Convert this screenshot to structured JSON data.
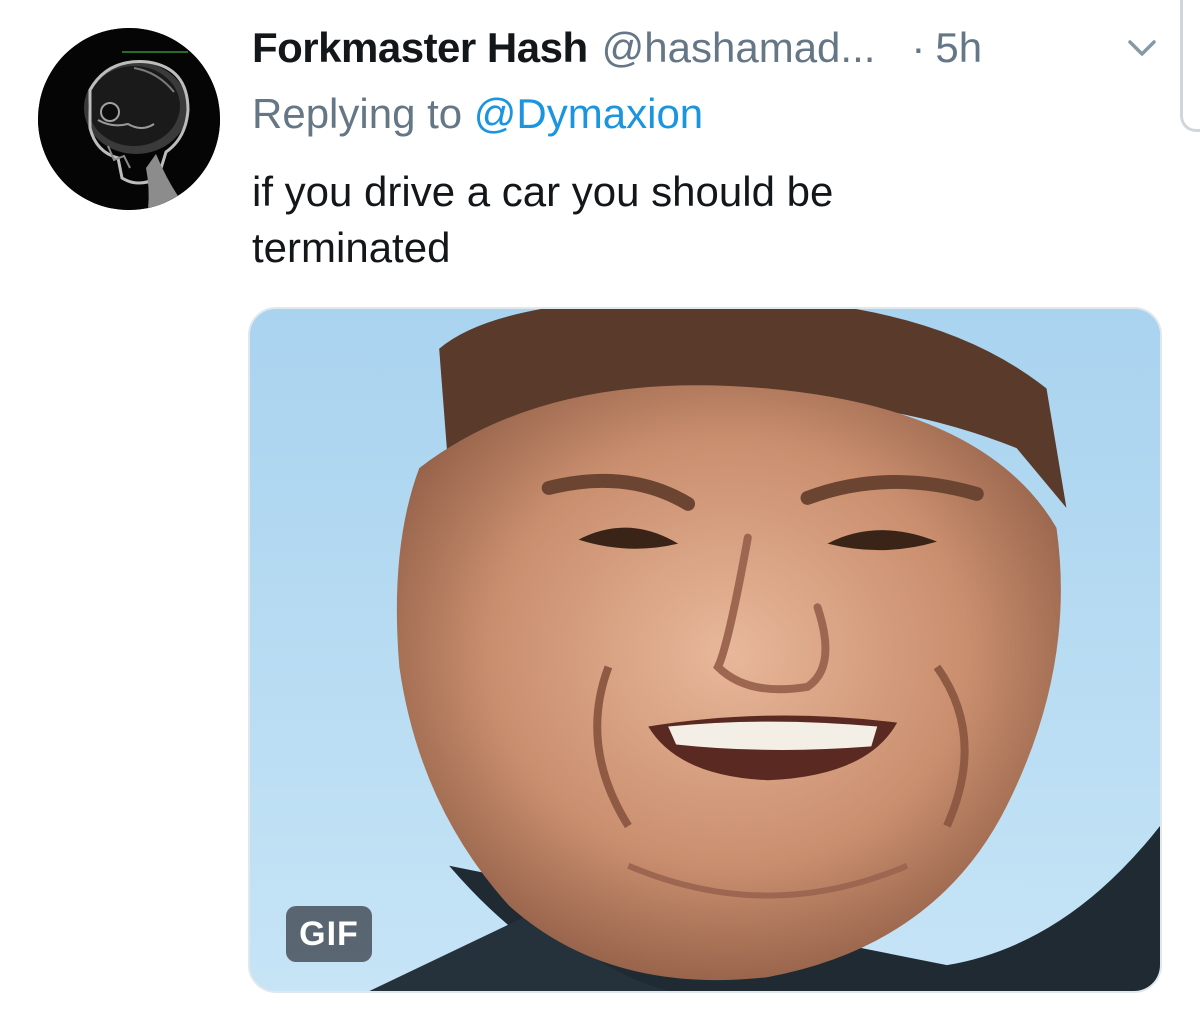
{
  "tweet": {
    "display_name": "Forkmaster Hash",
    "handle": "@hashamad...",
    "separator": "·",
    "time": "5h",
    "replying_prefix": "Replying to",
    "replying_to": "@Dymaxion",
    "text_lines": [
      "if you drive a car you should be",
      "terminated"
    ]
  },
  "media": {
    "badge": "GIF"
  },
  "icons": {
    "avatar": "skull-xray-avatar",
    "menu": "chevron-down-icon"
  },
  "colors": {
    "text_primary": "#14171a",
    "text_secondary": "#657786",
    "link": "#1b95e0",
    "media_sky": "#b9dcf2"
  }
}
